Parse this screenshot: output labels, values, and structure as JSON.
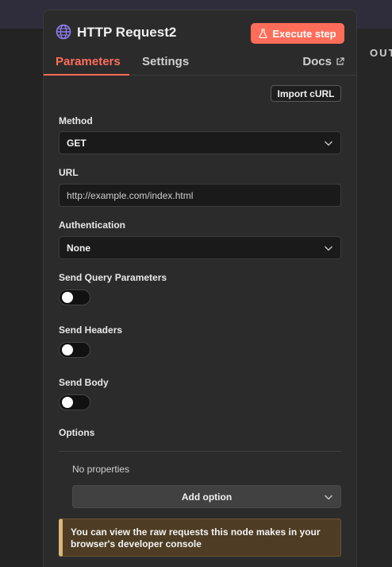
{
  "output": {
    "label": "OUTPUT"
  },
  "node": {
    "title": "HTTP Request2",
    "icon": "globe-icon"
  },
  "header": {
    "execute_label": "Execute step",
    "execute_icon": "flask-icon",
    "accent": "#ff6d5a"
  },
  "tabs": {
    "parameters": "Parameters",
    "settings": "Settings",
    "docs": "Docs",
    "docs_icon": "external-link-icon"
  },
  "import_label": "Import cURL",
  "fields": {
    "method": {
      "label": "Method",
      "value": "GET"
    },
    "url": {
      "label": "URL",
      "value": "http://example.com/index.html"
    },
    "auth": {
      "label": "Authentication",
      "value": "None"
    }
  },
  "toggles": {
    "query": {
      "label": "Send Query Parameters",
      "on": false
    },
    "headers": {
      "label": "Send Headers",
      "on": false
    },
    "body": {
      "label": "Send Body",
      "on": false
    }
  },
  "options": {
    "label": "Options",
    "empty_text": "No properties",
    "add_label": "Add option"
  },
  "notice": {
    "text": "You can view the raw requests this node makes in your browser's developer console"
  }
}
